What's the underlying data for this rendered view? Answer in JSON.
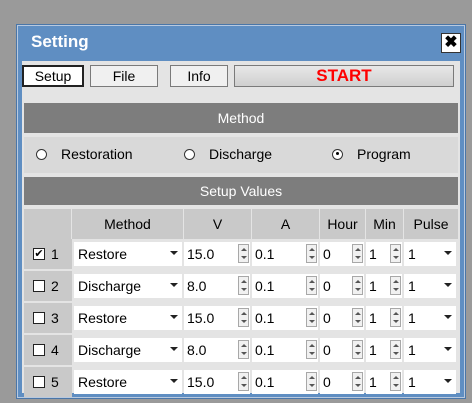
{
  "window": {
    "title": "Setting",
    "close_glyph": "✖"
  },
  "tabs": [
    {
      "label": "Setup",
      "active": true
    },
    {
      "label": "File",
      "active": false
    },
    {
      "label": "Info",
      "active": false
    }
  ],
  "start_button": {
    "label": "START",
    "color": "#ff0000"
  },
  "method_section": {
    "header": "Method",
    "options": [
      {
        "label": "Restoration",
        "selected": false
      },
      {
        "label": "Discharge",
        "selected": false
      },
      {
        "label": "Program",
        "selected": true
      }
    ]
  },
  "setup_values": {
    "header": "Setup Values",
    "columns": [
      "Method",
      "V",
      "A",
      "Hour",
      "Min",
      "Pulse"
    ],
    "rows": [
      {
        "checked": true,
        "index": "1",
        "method": "Restore",
        "v": "15.0",
        "a": "0.1",
        "hour": "0",
        "min": "1",
        "pulse": "1"
      },
      {
        "checked": false,
        "index": "2",
        "method": "Discharge",
        "v": "8.0",
        "a": "0.1",
        "hour": "0",
        "min": "1",
        "pulse": "1"
      },
      {
        "checked": false,
        "index": "3",
        "method": "Restore",
        "v": "15.0",
        "a": "0.1",
        "hour": "0",
        "min": "1",
        "pulse": "1"
      },
      {
        "checked": false,
        "index": "4",
        "method": "Discharge",
        "v": "8.0",
        "a": "0.1",
        "hour": "0",
        "min": "1",
        "pulse": "1"
      },
      {
        "checked": false,
        "index": "5",
        "method": "Restore",
        "v": "15.0",
        "a": "0.1",
        "hour": "0",
        "min": "1",
        "pulse": "1"
      }
    ]
  },
  "colors": {
    "title_bar": "#5f8ec2",
    "section_header": "#7d7d7d",
    "client_bg": "#e4e4e4"
  }
}
